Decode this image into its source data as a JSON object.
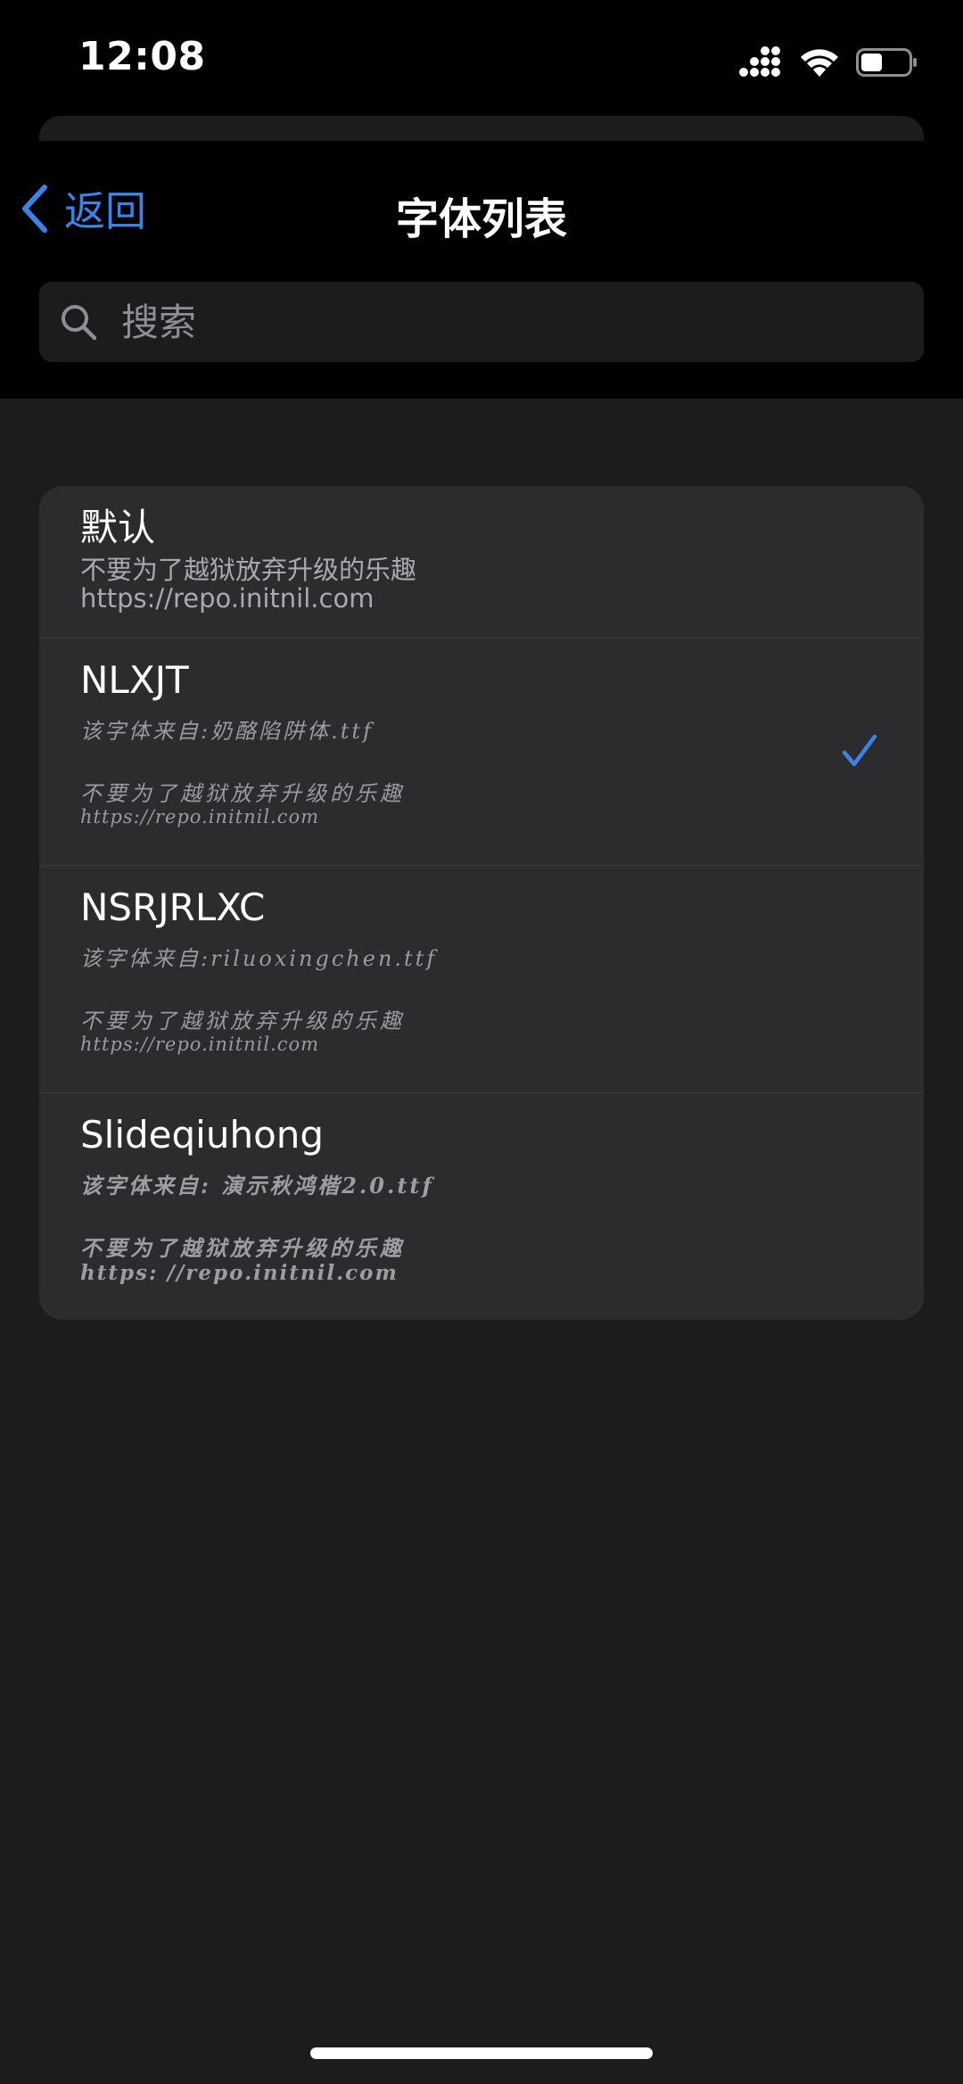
{
  "status_bar": {
    "time": "12:08",
    "battery_level": 0.45
  },
  "nav": {
    "back_label": "返回",
    "title": "字体列表"
  },
  "search": {
    "placeholder": "搜索",
    "value": ""
  },
  "fonts": [
    {
      "name": "默认",
      "motto": "不要为了越狱放弃升级的乐趣",
      "url": "https://repo.initnil.com",
      "selected": false
    },
    {
      "name": "NLXJT",
      "source": "该字体来自:奶酪陷阱体.ttf",
      "motto": "不要为了越狱放弃升级的乐趣",
      "url": "https://repo.initnil.com",
      "selected": true
    },
    {
      "name": "NSRJRLXC",
      "source": "该字体来自:riluoxingchen.ttf",
      "motto": "不要为了越狱放弃升级的乐趣",
      "url": "https://repo.initnil.com",
      "selected": false
    },
    {
      "name": "Slideqiuhong",
      "source": "该字体来自: 演示秋鸿楷2.0.ttf",
      "motto": "不要为了越狱放弃升级的乐趣",
      "url": "https: //repo.initnil.com",
      "selected": false
    }
  ],
  "colors": {
    "accent": "#3d82e6",
    "background": "#1c1c1e",
    "card": "#2c2c2e",
    "separator": "#3a3a3c"
  },
  "icons": {
    "back": "chevron-left-icon",
    "search": "search-icon",
    "selected": "checkmark-icon",
    "signal": "cellular-signal-icon",
    "wifi": "wifi-icon",
    "battery": "battery-icon"
  }
}
